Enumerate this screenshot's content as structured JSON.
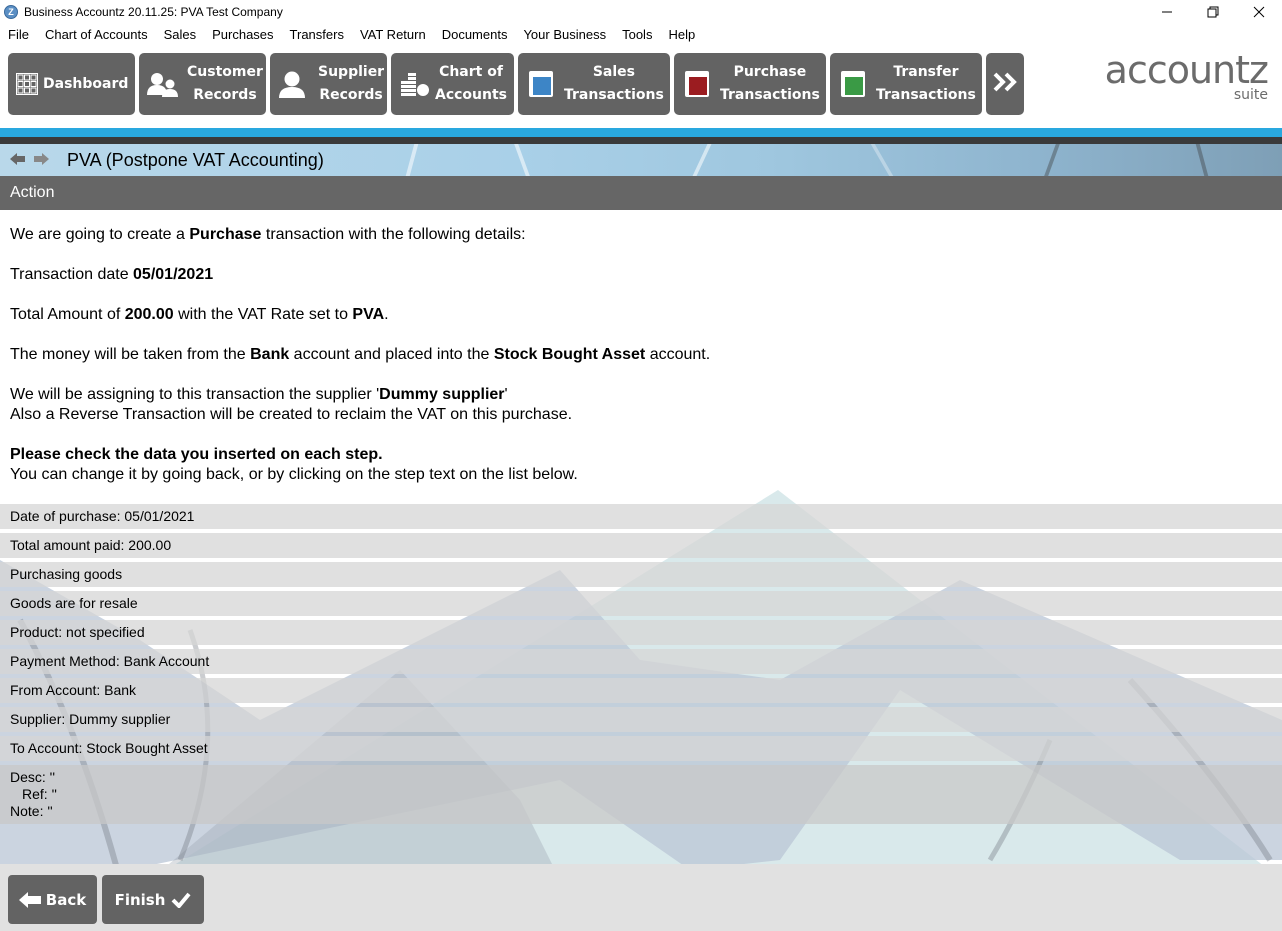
{
  "window": {
    "title": "Business Accountz 20.11.25: PVA Test Company",
    "controls": [
      "minimize",
      "restore",
      "close"
    ]
  },
  "menu": [
    "File",
    "Chart of Accounts",
    "Sales",
    "Purchases",
    "Transfers",
    "VAT Return",
    "Documents",
    "Your Business",
    "Tools",
    "Help"
  ],
  "toolbar": {
    "dashboard": "Dashboard",
    "customer_line1": "Customer",
    "customer_line2": "Records",
    "supplier_line1": "Supplier",
    "supplier_line2": "Records",
    "coa_line1": "Chart of",
    "coa_line2": "Accounts",
    "sales_line1": "Sales",
    "sales_line2": "Transactions",
    "purchase_line1": "Purchase",
    "purchase_line2": "Transactions",
    "transfer_line1": "Transfer",
    "transfer_line2": "Transactions",
    "more": "»",
    "colors": {
      "sales": "#3d85c6",
      "purchase": "#9b1c20",
      "transfer": "#3a9a45"
    }
  },
  "logo": {
    "main": "accountz",
    "sub": "suite"
  },
  "header": {
    "title": "PVA (Postpone VAT Accounting)",
    "section": "Action"
  },
  "content": {
    "p1_pre": "We are going to create a ",
    "p1_bold": "Purchase",
    "p1_post": " transaction with the following details:",
    "p2_pre": "Transaction date ",
    "p2_bold": "05/01/2021",
    "p3_pre": "Total Amount of ",
    "p3_bold1": "200.00",
    "p3_mid": " with the VAT Rate set to ",
    "p3_bold2": "PVA",
    "p3_post": ".",
    "p4_pre": "The money will be taken from the ",
    "p4_bold1": "Bank",
    "p4_mid": " account and placed into the ",
    "p4_bold2": "Stock Bought Asset",
    "p4_post": " account.",
    "p5_pre": "We will be assigning to this transaction the supplier '",
    "p5_bold": "Dummy supplier",
    "p5_post": "'",
    "p5_line2": "Also a Reverse Transaction will be created to reclaim the VAT on this purchase.",
    "p6_bold": "Please check the data you inserted on each step.",
    "p6_line2": "You can change it by going back, or by clicking on the step text on the list below."
  },
  "summary": [
    "Date of purchase: 05/01/2021",
    "Total amount paid: 200.00",
    "Purchasing goods",
    "Goods are for resale",
    "Product: not specified",
    "Payment Method: Bank Account",
    "From Account: Bank",
    "Supplier: Dummy supplier",
    "To Account: Stock Bought Asset"
  ],
  "summary_extra": {
    "desc": "Desc: ''",
    "ref": "Ref: ''",
    "note": "Note: ''"
  },
  "footer": {
    "back": "Back",
    "finish": "Finish"
  }
}
